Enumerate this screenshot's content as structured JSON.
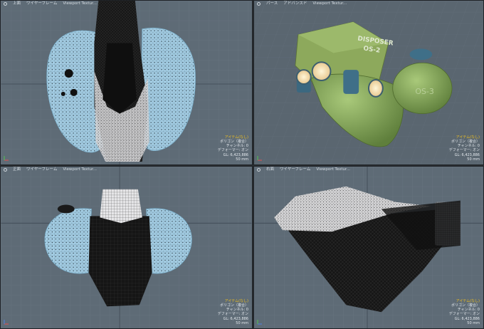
{
  "viewports": {
    "top": {
      "header": {
        "view": "上面",
        "shading": "ワイヤーフレーム",
        "texture": "Viewport Textur..."
      },
      "info": {
        "title": "アイテム(なし)",
        "polygons": "ポリゴン（複合）",
        "channels": "チャンネル: 0",
        "deformers": "デフォーマー: オン",
        "gl": "GL: 6,423,886",
        "scale": "50 mm"
      }
    },
    "perspective": {
      "header": {
        "view": "パース",
        "shading": "アドバンスド",
        "texture": "Viewport Textur..."
      },
      "info": {
        "title": "アイテム(なし)",
        "polygons": "ポリゴン（複合）",
        "channels": "チャンネル: 0",
        "deformers": "デフォーマー: オン",
        "gl": "GL: 6,423,886",
        "scale": "50 mm"
      },
      "model_text": {
        "primary": "DISPOSER",
        "secondary": "OS-2",
        "side": "OS-3"
      }
    },
    "front": {
      "header": {
        "view": "正面",
        "shading": "ワイヤーフレーム",
        "texture": "Viewport Textur..."
      },
      "info": {
        "title": "アイテム(なし)",
        "polygons": "ポリゴン（複合）",
        "channels": "チャンネル: 0",
        "deformers": "デフォーマー: オン",
        "gl": "GL: 6,423,886",
        "scale": "50 mm"
      }
    },
    "side": {
      "header": {
        "view": "右面",
        "shading": "ワイヤーフレーム",
        "texture": "Viewport Textur..."
      },
      "info": {
        "title": "アイテム(なし)",
        "polygons": "ポリゴン（複合）",
        "channels": "チャンネル: 0",
        "deformers": "デフォーマー: オン",
        "gl": "GL: 6,423,886",
        "scale": "50 mm"
      }
    }
  },
  "colors": {
    "viewport_bg": "#5e6b76",
    "grid_line": "#6c7985",
    "wire_blue": "#a9d3ea",
    "wire_white": "#e8e8ea",
    "model_green": "#8fb160",
    "info_title": "#f0c020"
  },
  "icons": {
    "header": "view-circle-icon",
    "gizmo": "axis-gizmo-icon"
  }
}
